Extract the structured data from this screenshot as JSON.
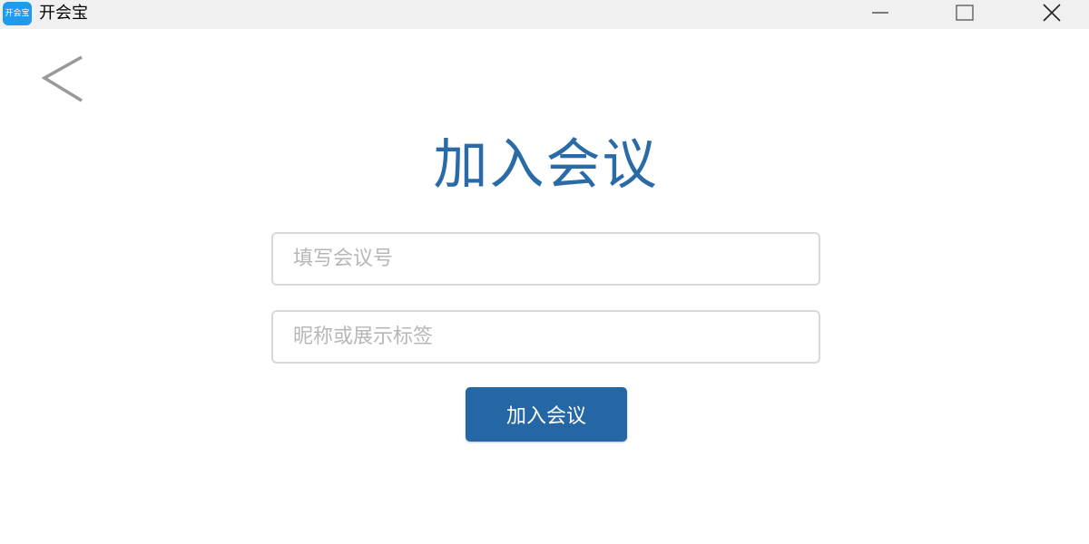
{
  "titlebar": {
    "app_icon_text": "开会宝",
    "title": "开会宝"
  },
  "icons": {
    "app": "app-logo-icon",
    "minimize": "minimize-icon",
    "maximize": "maximize-icon",
    "close": "close-icon",
    "back": "chevron-left-icon"
  },
  "main": {
    "title": "加入会议",
    "meeting_number": {
      "value": "",
      "placeholder": "填写会议号"
    },
    "nickname": {
      "value": "",
      "placeholder": "昵称或展示标签"
    },
    "join_label": "加入会议"
  },
  "colors": {
    "accent": "#2566a5",
    "title_text": "#2a6aa7",
    "app_icon": "#1e9bf0"
  }
}
